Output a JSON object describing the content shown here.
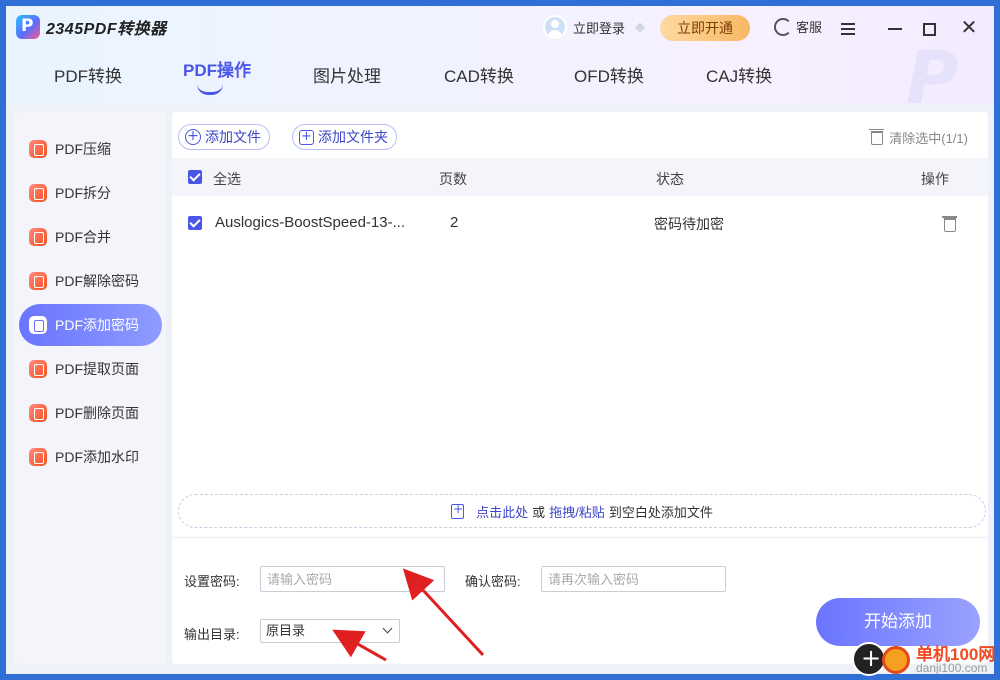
{
  "app": {
    "title": "2345PDF转换器",
    "login_label": "立即登录",
    "vip_button": "立即开通",
    "service_label": "客服"
  },
  "tabs": [
    {
      "label": "PDF转换"
    },
    {
      "label": "PDF操作",
      "active": true
    },
    {
      "label": "图片处理"
    },
    {
      "label": "CAD转换"
    },
    {
      "label": "OFD转换"
    },
    {
      "label": "CAJ转换"
    }
  ],
  "sidebar": {
    "items": [
      {
        "label": "PDF压缩"
      },
      {
        "label": "PDF拆分"
      },
      {
        "label": "PDF合并"
      },
      {
        "label": "PDF解除密码"
      },
      {
        "label": "PDF添加密码",
        "active": true
      },
      {
        "label": "PDF提取页面"
      },
      {
        "label": "PDF删除页面"
      },
      {
        "label": "PDF添加水印"
      }
    ]
  },
  "toolbar": {
    "add_file": "添加文件",
    "add_folder": "添加文件夹",
    "clear_selected": "清除选中(1/1)"
  },
  "table": {
    "headers": {
      "select_all": "全选",
      "pages": "页数",
      "status": "状态",
      "actions": "操作"
    },
    "rows": [
      {
        "name": "Auslogics-BoostSpeed-13-...",
        "pages": "2",
        "status": "密码待加密",
        "checked": true
      }
    ]
  },
  "drop_zone": {
    "click_here": "点击此处",
    "or": "或",
    "drag_paste": "拖拽/粘贴",
    "to_blank": "到空白处添加文件"
  },
  "settings": {
    "password_label": "设置密码:",
    "password_placeholder": "请输入密码",
    "confirm_label": "确认密码:",
    "confirm_placeholder": "请再次输入密码",
    "output_label": "输出目录:",
    "output_value": "原目录",
    "start_button": "开始添加"
  },
  "watermark": {
    "site_name": "单机100网",
    "site_url": "danji100.com"
  },
  "colors": {
    "accent": "#4a56e6",
    "annotation_arrow": "#e02020",
    "window_border": "#2f6fd6"
  }
}
